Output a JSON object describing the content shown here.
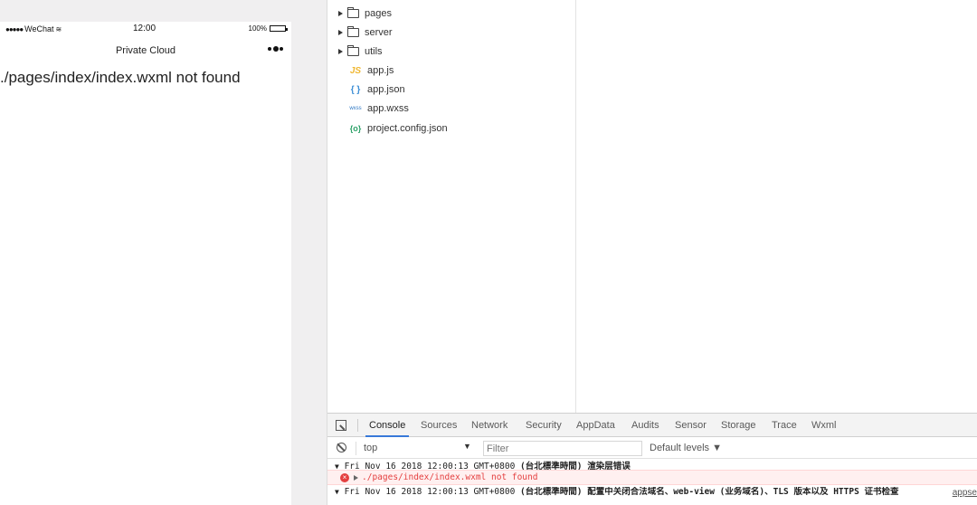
{
  "simulator": {
    "status_bar": {
      "carrier": "WeChat",
      "time": "12:00",
      "battery": "100%"
    },
    "nav_title": "Private Cloud",
    "error_message": "./pages/index/index.wxml not found"
  },
  "file_tree": {
    "folders": [
      {
        "label": "pages"
      },
      {
        "label": "server"
      },
      {
        "label": "utils"
      }
    ],
    "files": [
      {
        "label": "app.js",
        "icon": "JS"
      },
      {
        "label": "app.json",
        "icon": "{ }"
      },
      {
        "label": "app.wxss",
        "icon": "wxss"
      },
      {
        "label": "project.config.json",
        "icon": "{o}"
      }
    ]
  },
  "devtools": {
    "tabs": [
      "Console",
      "Sources",
      "Network",
      "Security",
      "AppData",
      "Audits",
      "Sensor",
      "Storage",
      "Trace",
      "Wxml"
    ],
    "active_tab": "Console",
    "context": "top",
    "filter_placeholder": "Filter",
    "levels": "Default levels ▼",
    "logs": {
      "line1_time": "Fri Nov 16 2018 12:00:13 GMT+0800",
      "line1_msg": "(台北標準時間) 渲染层错误",
      "error": "./pages/index/index.wxml not found",
      "line3_time": "Fri Nov 16 2018 12:00:13 GMT+0800",
      "line3_msg": "(台北標準時間) 配置中关闭合法域名、web-view (业务域名)、TLS 版本以及 HTTPS 证书检查",
      "source": "appse"
    }
  },
  "colors": {
    "accent": "#3879d9",
    "error": "#e43f3f",
    "simulator_bg": "#f0eff0"
  }
}
